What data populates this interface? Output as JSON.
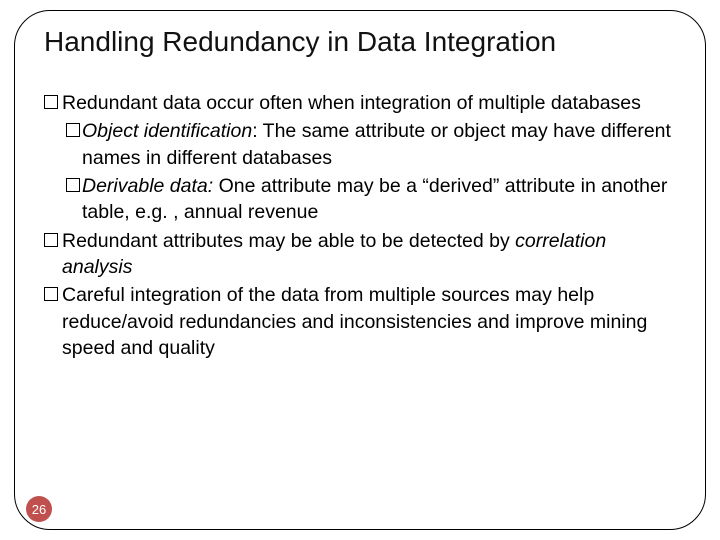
{
  "title": "Handling Redundancy in Data Integration",
  "bullets": {
    "b1_intro": "Redundant data occur often when integration of multiple databases",
    "b2_obj_label": "Object identification",
    "b2_obj_rest": ":  The same attribute or object may have different names in different databases",
    "b2_der_label": "Derivable data:",
    "b2_der_rest": " One attribute may be a “derived” attribute in another table, e.g. , annual revenue",
    "b1_corr_a": "Redundant attributes may be able to be detected by ",
    "b1_corr_em": "correlation analysis",
    "b1_careful": "Careful integration of the data from multiple sources may help reduce/avoid redundancies and inconsistencies and improve mining speed and quality"
  },
  "page_number": "26"
}
